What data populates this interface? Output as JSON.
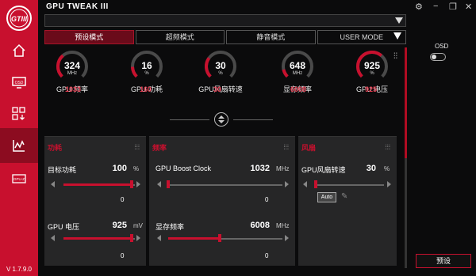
{
  "app": {
    "title": "GPU TWEAK III",
    "version": "V 1.7.9.0",
    "logo_text": "GTIII"
  },
  "window_controls": [
    "settings-icon",
    "minimize-icon",
    "maximize-icon",
    "close-icon"
  ],
  "sidebar": {
    "items": [
      {
        "name": "home",
        "icon": "home-icon",
        "active": false
      },
      {
        "name": "osd",
        "icon": "osd-icon",
        "active": false
      },
      {
        "name": "profiles",
        "icon": "grid-download-icon",
        "active": false
      },
      {
        "name": "monitor",
        "icon": "chart-icon",
        "active": true
      },
      {
        "name": "gpu-info",
        "icon": "gpu-z-icon",
        "active": false
      }
    ]
  },
  "tabs": [
    {
      "label": "预设模式",
      "active": true
    },
    {
      "label": "超频模式",
      "active": false
    },
    {
      "label": "静音模式",
      "active": false
    },
    {
      "label": "USER MODE",
      "active": false
    }
  ],
  "gauges": [
    {
      "value": "324",
      "unit": "MHz",
      "secondary": "1033",
      "label": "GPU 频率",
      "level": 0.35
    },
    {
      "value": "16",
      "unit": "%",
      "secondary": "160",
      "label": "GPU 功耗",
      "level": 0.16
    },
    {
      "value": "30",
      "unit": "%",
      "secondary": "30",
      "label": "GPU风扇转速",
      "level": 0.3
    },
    {
      "value": "648",
      "unit": "MHz",
      "secondary": "6008",
      "label": "显存频率",
      "level": 0.12
    },
    {
      "value": "925",
      "unit": "%",
      "secondary": "925",
      "label": "GPU 电压",
      "level": 0.65
    }
  ],
  "panels": {
    "power": {
      "title": "功耗",
      "rows": [
        {
          "label": "目标功耗",
          "value": "100",
          "unit": "%",
          "offset": "0",
          "fill": 0.95
        },
        {
          "label": "GPU 电压",
          "value": "925",
          "unit": "mV",
          "offset": "0",
          "fill": 0.95
        }
      ]
    },
    "freq": {
      "title": "频率",
      "rows": [
        {
          "label": "GPU Boost Clock",
          "value": "1032",
          "unit": "MHz",
          "offset": "0",
          "fill": 0.0
        },
        {
          "label": "显存频率",
          "value": "6008",
          "unit": "MHz",
          "offset": "0",
          "fill": 0.45
        }
      ]
    },
    "fan": {
      "title": "风扇",
      "rows": [
        {
          "label": "GPU风扇转速",
          "value": "30",
          "unit": "%",
          "offset": "",
          "fill": 0.0
        }
      ],
      "auto_label": "Auto"
    }
  },
  "osd": {
    "label": "OSD",
    "enabled": false
  },
  "preset_button": "预设",
  "colors": {
    "accent": "#c8102e",
    "panel": "#262627",
    "bg": "#0b0b0c"
  }
}
